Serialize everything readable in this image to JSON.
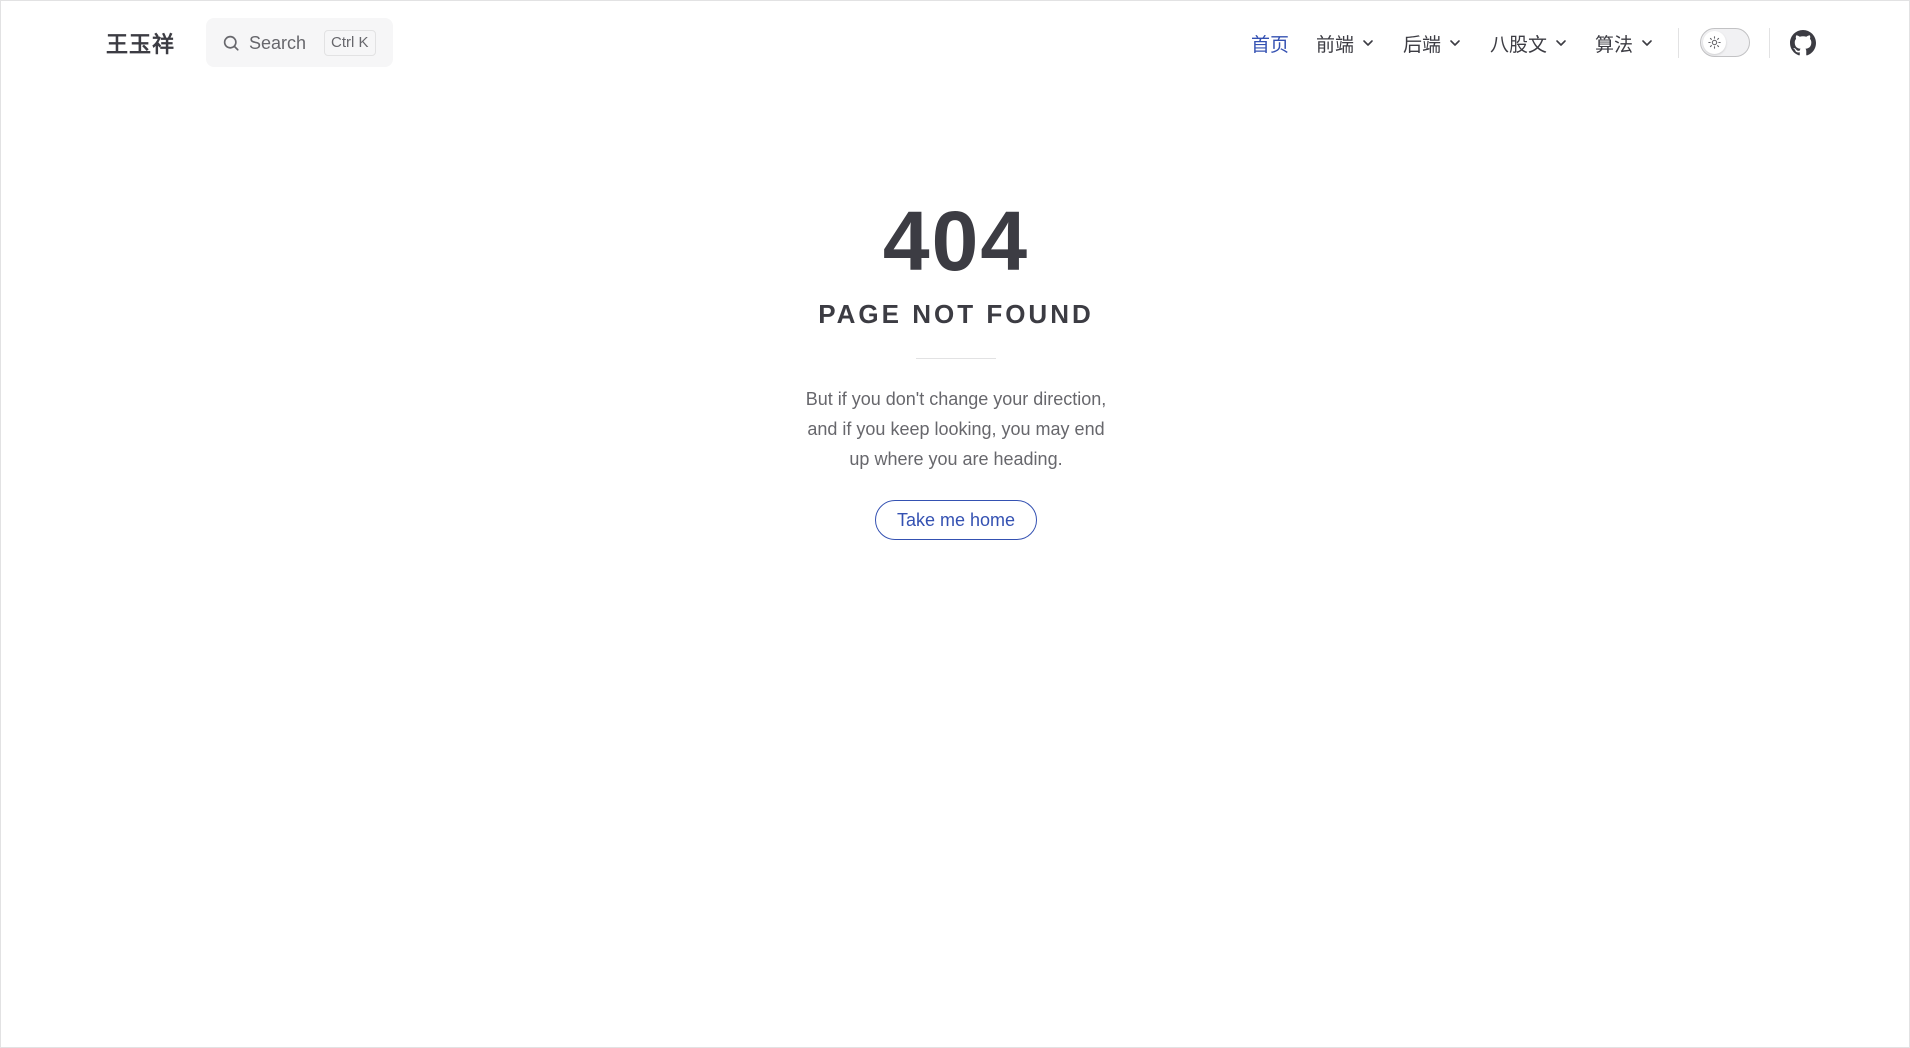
{
  "site": {
    "logo_text": "王玉祥"
  },
  "search": {
    "label": "Search",
    "shortcut_ctrl": "Ctrl",
    "shortcut_key": "K"
  },
  "nav": {
    "items": [
      {
        "label": "首页",
        "active": true,
        "dropdown": false
      },
      {
        "label": "前端",
        "active": false,
        "dropdown": true
      },
      {
        "label": "后端",
        "active": false,
        "dropdown": true
      },
      {
        "label": "八股文",
        "active": false,
        "dropdown": true
      },
      {
        "label": "算法",
        "active": false,
        "dropdown": true
      }
    ]
  },
  "appearance_toggle": {
    "icon": "sun-icon",
    "state": "light"
  },
  "social": {
    "icon": "github-icon"
  },
  "not_found": {
    "code": "404",
    "title": "PAGE NOT FOUND",
    "quote_line1": "But if you don't change your direction,",
    "quote_line2": "and if you keep looking, you may end",
    "quote_line3": "up where you are heading.",
    "home_button": "Take me home"
  },
  "colors": {
    "brand": "#3451b2",
    "text": "#3c3c43",
    "muted": "#67676c",
    "divider": "#e2e2e3",
    "search_bg": "#f6f6f7"
  }
}
